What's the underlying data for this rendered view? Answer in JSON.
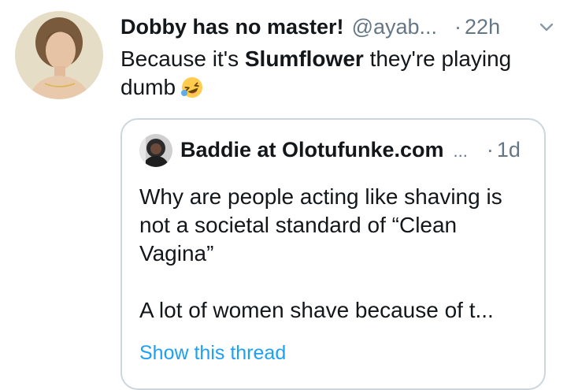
{
  "tweet": {
    "display_name": "Dobby has no master!",
    "handle": "@ayab...",
    "dot": "·",
    "time": "22h",
    "text_before": "Because it's ",
    "text_bold": "Slumflower",
    "text_after": " they're playing dumb",
    "emoji": "laughing-face-emoji",
    "menu_icon": "chevron-down-icon"
  },
  "quoted_tweet": {
    "display_name": "Baddie at Olotufunke.com",
    "handle": "...",
    "dot": "·",
    "time": "1d",
    "text_line1": "Why are people acting like shaving is not a societal standard of “Clean Vagina”",
    "text_line2": "A lot of women shave because of t...",
    "show_thread": "Show this thread"
  },
  "colors": {
    "text": "#14171a",
    "secondary": "#657786",
    "link": "#1da1f2",
    "border": "#ccd6dd"
  }
}
